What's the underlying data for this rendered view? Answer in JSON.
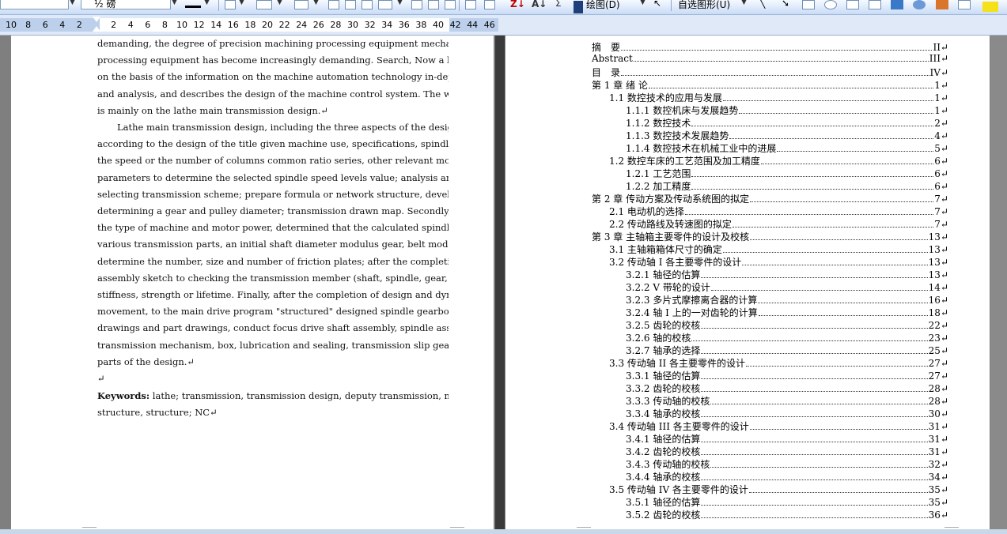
{
  "toolbar": {
    "font_size": "½ 磅",
    "drawing_label": "绘图(D)",
    "autoshapes_label": "自选图形(U)"
  },
  "ruler": {
    "ticks": [
      "10",
      "8",
      "6",
      "4",
      "2",
      "",
      "2",
      "4",
      "6",
      "8",
      "10",
      "12",
      "14",
      "16",
      "18",
      "20",
      "22",
      "24",
      "26",
      "28",
      "30",
      "32",
      "34",
      "36",
      "38",
      "40",
      "42",
      "44",
      "46"
    ]
  },
  "left_page": {
    "lines": [
      "demanding, the degree of precision machining processing equipment mechanical",
      "processing equipment has become increasingly demanding. Search, Now a lot of research",
      "on the basis of the information on the machine automation technology in-depth research",
      "and analysis, and describes the design of the machine control system. The whole process",
      "is mainly on the lathe main transmission design.↵",
      "Lathe main transmission design, including the three aspects of the design, namely:",
      "according to the design of the title given machine use, specifications, spindle speed limit,",
      "the speed or the number of columns common ratio series, other relevant motion",
      "parameters to determine the selected spindle speed levels value; analysis and comparison,",
      "selecting transmission scheme; prepare formula or network structure, develop speed;",
      "determining a gear and pulley diameter; transmission drawn map. Secondly, according to",
      "the type of machine and motor power, determined that the calculated spindle speed and",
      "various transmission parts, an initial shaft diameter modulus gear, belt model and",
      "determine the number, size and number of friction plates; after the completion of",
      "assembly sketch to checking the transmission member (shaft, spindle, gear, bearing)",
      "stiffness, strength or lifetime. Finally, after the completion of design and dynamic design",
      "movement, to the main drive program \"structured\" designed spindle gearbox assembly",
      "drawings and part drawings, conduct focus drive shaft assembly, spindle assembly,",
      "transmission mechanism, box, lubrication and sealing, transmission slip gear shaft and",
      "parts of the design.↵",
      "↵"
    ],
    "keywords_label": "Keywords:",
    "keywords_line1": "lathe; transmission, transmission design, deputy transmission, network",
    "keywords_line2": "structure, structure; NC↵"
  },
  "toc": [
    {
      "title": "摘　要",
      "page": "II↵",
      "level": 0
    },
    {
      "title": "Abstract",
      "page": "III↵",
      "level": 0
    },
    {
      "title": "目　录",
      "page": "IV↵",
      "level": 0
    },
    {
      "title": "第 1 章  绪  论",
      "page": "1↵",
      "level": 0
    },
    {
      "title": "1.1  数控技术的应用与发展",
      "page": "1↵",
      "level": 1
    },
    {
      "title": "1.1.1 数控机床与发展趋势",
      "page": "1↵",
      "level": 2
    },
    {
      "title": "1.1.2 数控技术",
      "page": "2↵",
      "level": 2
    },
    {
      "title": "1.1.3 数控技术发展趋势",
      "page": "4↵",
      "level": 2
    },
    {
      "title": "1.1.4 数控技术在机械工业中的进展",
      "page": "5↵",
      "level": 2
    },
    {
      "title": "1.2 数控车床的工艺范围及加工精度",
      "page": "6↵",
      "level": 1
    },
    {
      "title": "1.2.1 工艺范围",
      "page": "6↵",
      "level": 2
    },
    {
      "title": "1.2.2 加工精度",
      "page": "6↵",
      "level": 2
    },
    {
      "title": "第 2 章    传动方案及传动系统图的拟定",
      "page": "7↵",
      "level": 0
    },
    {
      "title": "2.1  电动机的选择",
      "page": "7↵",
      "level": 1
    },
    {
      "title": "2.2  传动路线及转速图的拟定",
      "page": "7↵",
      "level": 1
    },
    {
      "title": "第 3 章    主轴箱主要零件的设计及校核",
      "page": "13↵",
      "level": 0
    },
    {
      "title": "3.1    主轴箱箱体尺寸的确定",
      "page": "13↵",
      "level": 1
    },
    {
      "title": "3.2    传动轴 I 各主要零件的设计",
      "page": "13↵",
      "level": 1
    },
    {
      "title": "3.2.1    轴径的估算",
      "page": "13↵",
      "level": 2
    },
    {
      "title": "3.2.2    V 带轮的设计",
      "page": "14↵",
      "level": 2
    },
    {
      "title": "3.2.3    多片式摩擦离合器的计算",
      "page": "16↵",
      "level": 2
    },
    {
      "title": "3.2.4    轴 I 上的一对齿轮的计算",
      "page": "18↵",
      "level": 2
    },
    {
      "title": "3.2.5    齿轮的校核",
      "page": "22↵",
      "level": 2
    },
    {
      "title": "3.2.6    轴的校核",
      "page": "23↵",
      "level": 2
    },
    {
      "title": "3.2.7    轴承的选择",
      "page": "25↵",
      "level": 2
    },
    {
      "title": "3.3    传动轴 II 各主要零件的设计",
      "page": "27↵",
      "level": 1
    },
    {
      "title": "3.3.1    轴径的估算",
      "page": "27↵",
      "level": 2
    },
    {
      "title": "3.3.2    齿轮的校核",
      "page": "28↵",
      "level": 2
    },
    {
      "title": "3.3.3    传动轴的校核",
      "page": "28↵",
      "level": 2
    },
    {
      "title": "3.3.4    轴承的校核",
      "page": "30↵",
      "level": 2
    },
    {
      "title": "3.4    传动轴 III 各主要零件的设计",
      "page": "31↵",
      "level": 1
    },
    {
      "title": "3.4.1    轴径的估算",
      "page": "31↵",
      "level": 2
    },
    {
      "title": "3.4.2    齿轮的校核",
      "page": "31↵",
      "level": 2
    },
    {
      "title": "3.4.3    传动轴的校核",
      "page": "32↵",
      "level": 2
    },
    {
      "title": "3.4.4    轴承的校核",
      "page": "34↵",
      "level": 2
    },
    {
      "title": "3.5    传动轴 IV 各主要零件的设计",
      "page": "35↵",
      "level": 1
    },
    {
      "title": "3.5.1    轴径的估算",
      "page": "35↵",
      "level": 2
    },
    {
      "title": "3.5.2    齿轮的校核",
      "page": "36↵",
      "level": 2
    }
  ]
}
